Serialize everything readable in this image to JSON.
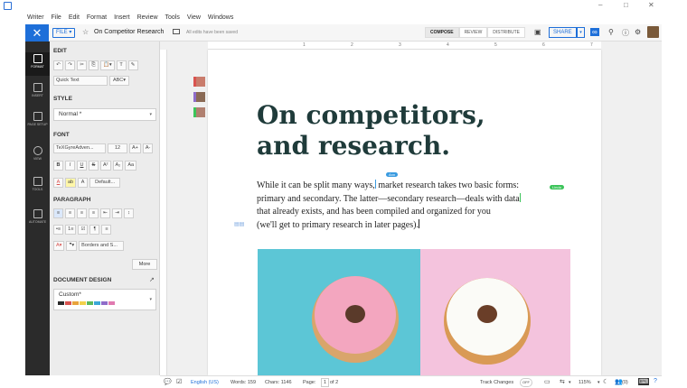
{
  "menu": [
    "Writer",
    "File",
    "Edit",
    "Format",
    "Insert",
    "Review",
    "Tools",
    "View",
    "Windows"
  ],
  "window_controls": [
    "–",
    "□",
    "✕"
  ],
  "toolbar": {
    "close": "✕",
    "file_label": "FILE ▾",
    "star": "☆",
    "doc_title": "On Competitor Research",
    "saved_status": "All edits have been saved",
    "modes": [
      "COMPOSE",
      "REVIEW",
      "DISTRIBUTE"
    ],
    "share_label": "SHARE",
    "share_caret": "▾"
  },
  "rail": [
    "FORMAT",
    "INSERT",
    "PAGE SETUP",
    "VIEW",
    "TOOLS",
    "AUTOMATE"
  ],
  "panel": {
    "edit_label": "EDIT",
    "edit_buttons": [
      "↶",
      "↷",
      "✂",
      "⎘",
      "📋▾",
      "T",
      "✎"
    ],
    "quick_text": "Quick Text",
    "style_label": "STYLE",
    "style_value": "Normal *",
    "font_label": "FONT",
    "font_name": "TeXGyreAdven...",
    "font_size": "12",
    "font_grow": "A+",
    "font_shrink": "A-",
    "format_buttons": [
      "B",
      "I",
      "U",
      "S",
      "A²",
      "A₂",
      "Aa"
    ],
    "color_buttons": [
      "A",
      "ab",
      "A"
    ],
    "default_label": "Default...",
    "paragraph_label": "PARAGRAPH",
    "align_buttons": [
      "≡",
      "≡",
      "≡",
      "≡",
      "⇤",
      "⇥",
      "↕"
    ],
    "list_buttons": [
      "•≡",
      "1≡",
      "☑",
      "¶",
      "≡"
    ],
    "borders_label": "Borders and S...",
    "more_label": "More",
    "doc_design_label": "DOCUMENT DESIGN",
    "doc_design_value": "Custom*",
    "design_colors": [
      "#2b2b2b",
      "#d9534f",
      "#e8a33b",
      "#f2d04a",
      "#5cb85c",
      "#3aa7d6",
      "#8e6cc9",
      "#e07ab0"
    ]
  },
  "ruler_numbers": [
    "1",
    "2",
    "3",
    "4",
    "5",
    "6",
    "7"
  ],
  "document": {
    "heading_line1": "On competitors,",
    "heading_line2": "and research.",
    "p1a": "While it can be split many ways,",
    "p1b": " market research takes two basic forms:",
    "p2": "primary and secondary. The latter—secondary research—deals with data",
    "p3": "that already exists, and has been compiled and organized for you",
    "p4": "(we'll get to primary research in later pages).",
    "cursor_tags": [
      "Ann",
      "Linda"
    ]
  },
  "status_bar": {
    "language": "English (US)",
    "words": "Words: 159",
    "chars": "Chars: 1146",
    "page_label": "Page:",
    "page_num": "1",
    "page_total": "of 2",
    "track_changes": "Track Changes",
    "track_state": "OFF",
    "zoom": "115%",
    "comments": "(0)"
  },
  "colors": {
    "accent": "#1e6fd9",
    "heading": "#1f3b3a",
    "rail": "#2b2b2b",
    "cursor_blue": "#3a9be0",
    "cursor_green": "#3cc45a"
  }
}
